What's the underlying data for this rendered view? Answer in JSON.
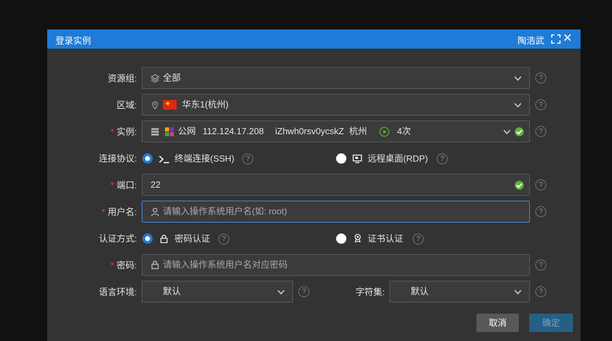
{
  "dialog": {
    "title": "登录实例",
    "user": "陶浩武",
    "close_symbol": "✕"
  },
  "form": {
    "resource_group": {
      "label": "资源组:",
      "value": "全部"
    },
    "region": {
      "label": "区域:",
      "value": "华东1(杭州)",
      "flag": "★"
    },
    "instance": {
      "required_mark": "*",
      "label": "实例:",
      "network": "公网",
      "ip": "112.124.17.208",
      "id": "iZhwh0rsv0ycskZ",
      "city": "杭州",
      "login_count": "4次"
    },
    "protocol": {
      "label": "连接协议:",
      "options": [
        {
          "label": "终端连接(SSH)",
          "selected": true
        },
        {
          "label": "远程桌面(RDP)",
          "selected": false
        }
      ]
    },
    "port": {
      "required_mark": "*",
      "label": "端口:",
      "value": "22"
    },
    "username": {
      "required_mark": "*",
      "label": "用户名:",
      "placeholder": "请输入操作系统用户名(如: root)"
    },
    "auth": {
      "label": "认证方式:",
      "options": [
        {
          "label": "密码认证",
          "selected": true
        },
        {
          "label": "证书认证",
          "selected": false
        }
      ]
    },
    "password": {
      "required_mark": "*",
      "label": "密码:",
      "placeholder": "请输入操作系统用户名对应密码"
    },
    "language": {
      "label": "语言环境:",
      "value": "默认"
    },
    "charset": {
      "label": "字符集:",
      "value": "默认"
    },
    "help_symbol": "?"
  },
  "buttons": {
    "cancel": "取消",
    "confirm": "确定"
  },
  "colors": {
    "accent": "#1e7bd7",
    "ok": "#5fb13a",
    "required": "#e84040"
  }
}
